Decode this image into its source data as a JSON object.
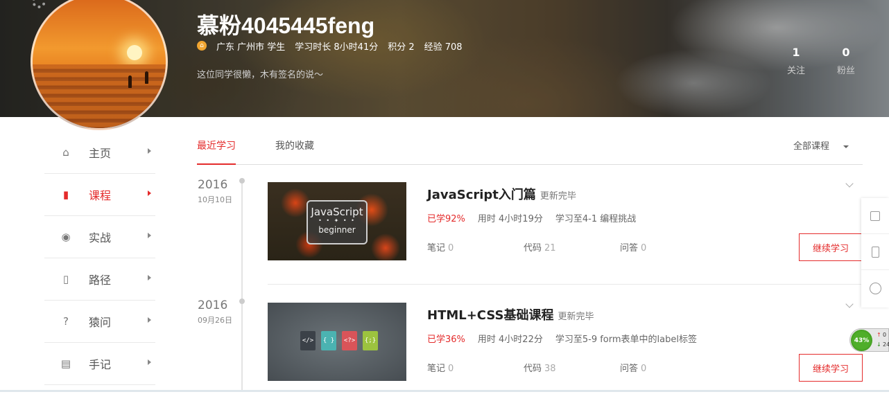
{
  "profile": {
    "name": "慕粉4045445feng",
    "location": "广东 广州市 学生",
    "study_time": "学习时长 8小时41分",
    "points": "积分 2",
    "experience": "经验 708",
    "signature": "这位同学很懒，木有签名的说～",
    "following_count": "1",
    "following_label": "关注",
    "followers_count": "0",
    "followers_label": "粉丝"
  },
  "sidebar": {
    "items": [
      {
        "label": "主页",
        "icon": "home-icon",
        "active": false
      },
      {
        "label": "课程",
        "icon": "book-icon",
        "active": true
      },
      {
        "label": "实战",
        "icon": "signal-icon",
        "active": false
      },
      {
        "label": "路径",
        "icon": "clipboard-icon",
        "active": false
      },
      {
        "label": "猿问",
        "icon": "question-icon",
        "active": false
      },
      {
        "label": "手记",
        "icon": "notes-icon",
        "active": false
      }
    ]
  },
  "tabs": {
    "recent": "最近学习",
    "favorites": "我的收藏",
    "filter": "全部课程"
  },
  "courses": [
    {
      "year": "2016",
      "date": "10月10日",
      "title": "JavaScript入门篇",
      "status": "更新完毕",
      "progress": "已学92%",
      "duration": "用时 4小时19分",
      "last": "学习至4-1 编程挑战",
      "notes_label": "笔记",
      "notes": "0",
      "code_label": "代码",
      "code": "21",
      "qa_label": "问答",
      "qa": "0",
      "button": "继续学习",
      "thumb_line1": "JavaScript",
      "thumb_line2": "beginner"
    },
    {
      "year": "2016",
      "date": "09月26日",
      "title": "HTML+CSS基础课程",
      "status": "更新完毕",
      "progress": "已学36%",
      "duration": "用时 4小时22分",
      "last": "学习至5-9 form表单中的label标签",
      "notes_label": "笔记",
      "notes": "0",
      "code_label": "代码",
      "code": "38",
      "qa_label": "问答",
      "qa": "0",
      "button": "继续学习",
      "thumb_files": [
        "</>",
        "{ }",
        "<?>",
        "{;}"
      ]
    }
  ],
  "speed_widget": {
    "percent": "43%",
    "up": "0",
    "down": "24"
  },
  "colors": {
    "accent": "#e42b2b",
    "file_dark": "#3b4148",
    "file_teal": "#4bb3b1",
    "file_red": "#d95459",
    "file_green": "#9cc33f"
  }
}
